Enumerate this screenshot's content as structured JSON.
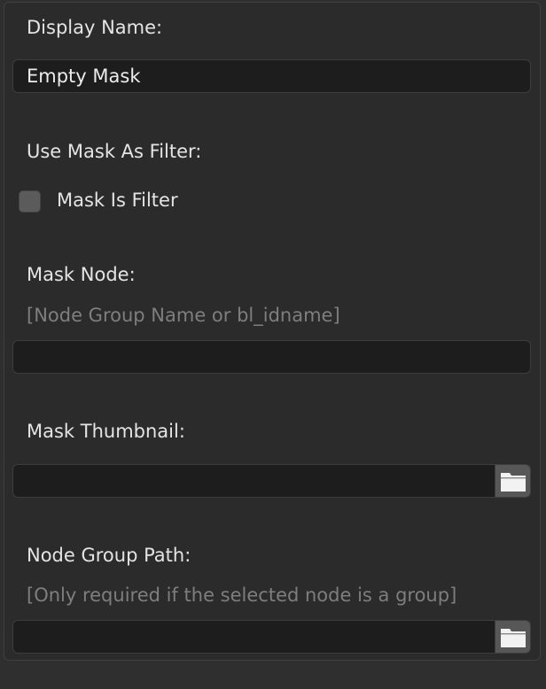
{
  "display_name": {
    "label": "Display Name:",
    "value": "Empty Mask"
  },
  "use_mask_as_filter": {
    "label": "Use Mask As Filter:",
    "checkbox_label": "Mask Is Filter",
    "checked": false
  },
  "mask_node": {
    "label": "Mask Node:",
    "hint": "[Node Group Name or bl_idname]",
    "value": ""
  },
  "mask_thumbnail": {
    "label": "Mask Thumbnail:",
    "value": "",
    "button_icon": "folder-icon"
  },
  "node_group_path": {
    "label": "Node Group Path:",
    "hint": "[Only required if the selected node is a group]",
    "value": "",
    "button_icon": "folder-icon"
  },
  "colors": {
    "panel_bg": "#2b2b2b",
    "field_bg": "#1d1d1d",
    "button_bg": "#575757",
    "hint_text": "#7e7e7e"
  }
}
